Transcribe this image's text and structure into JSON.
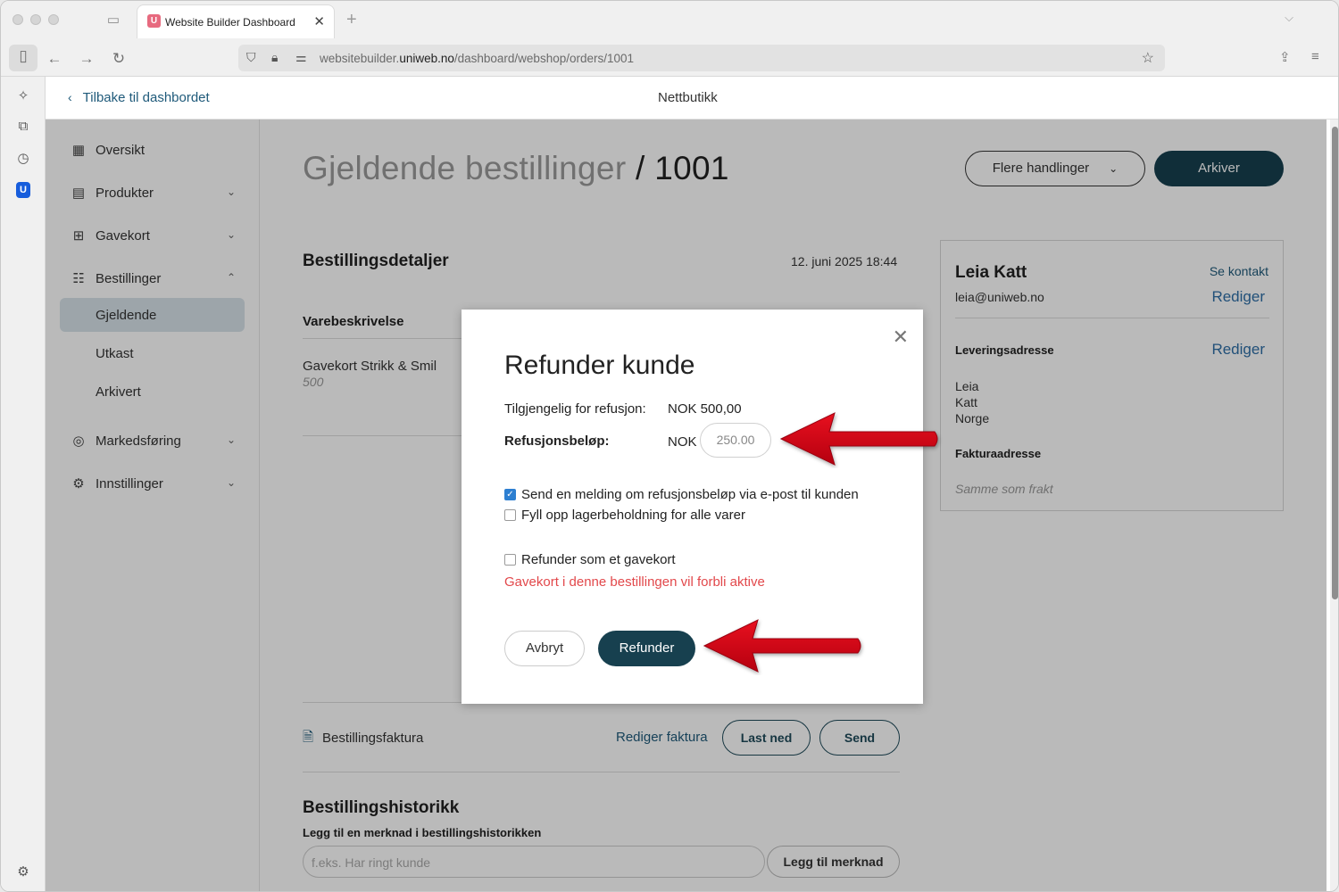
{
  "browser": {
    "tab_title": "Website Builder Dashboard",
    "tab_favicon_letter": "U",
    "url_prefix": "websitebuilder.",
    "url_domain": "uniweb.no",
    "url_path": "/dashboard/webshop/orders/1001"
  },
  "header": {
    "back_label": "Tilbake til dashbordet",
    "center_title": "Nettbutikk"
  },
  "sidebar": {
    "items": [
      {
        "label": "Oversikt",
        "icon": "grid-icon"
      },
      {
        "label": "Produkter",
        "icon": "box-icon"
      },
      {
        "label": "Gavekort",
        "icon": "gift-icon"
      },
      {
        "label": "Bestillinger",
        "icon": "list-icon"
      },
      {
        "label": "Markedsføring",
        "icon": "target-icon"
      },
      {
        "label": "Innstillinger",
        "icon": "gear-icon"
      }
    ],
    "sub_items": [
      "Gjeldende",
      "Utkast",
      "Arkivert"
    ]
  },
  "page": {
    "title_prefix": "Gjeldende bestillinger",
    "title_sep": " / ",
    "order_number": "1001",
    "more_actions_label": "Flere handlinger",
    "archive_label": "Arkiver"
  },
  "order_details": {
    "title": "Bestillingsdetaljer",
    "date": "12. juni 2025 18:44",
    "column_header": "Varebeskrivelse",
    "item_name": "Gavekort Strikk & Smil",
    "item_value": "500"
  },
  "invoice": {
    "label": "Bestillingsfaktura",
    "edit_label": "Rediger faktura",
    "download_label": "Last ned",
    "send_label": "Send"
  },
  "history": {
    "title": "Bestillingshistorikk",
    "note_label": "Legg til en merknad i bestillingshistorikken",
    "note_placeholder": "f.eks. Har ringt kunde",
    "add_note_label": "Legg til merknad"
  },
  "customer": {
    "name": "Leia Katt",
    "see_contact": "Se kontakt",
    "email": "leia@uniweb.no",
    "edit_label": "Rediger",
    "shipping_title": "Leveringsadresse",
    "shipping_lines": [
      "Leia",
      "Katt",
      "Norge"
    ],
    "billing_title": "Fakturaadresse",
    "billing_value": "Samme som frakt"
  },
  "modal": {
    "title": "Refunder kunde",
    "available_label": "Tilgjengelig for refusjon:",
    "available_value": "NOK 500,00",
    "amount_label": "Refusjonsbeløp:",
    "currency": "NOK",
    "amount_value": "250.00",
    "cb_email_label": "Send en melding om refusjonsbeløp via e-post til kunden",
    "cb_email_checked": true,
    "cb_restock_label": "Fyll opp lagerbeholdning for alle varer",
    "cb_restock_checked": false,
    "cb_giftcard_label": "Refunder som et gavekort",
    "cb_giftcard_checked": false,
    "warning": "Gavekort i denne bestillingen vil forbli aktive",
    "cancel_label": "Avbryt",
    "refund_label": "Refunder"
  },
  "colors": {
    "accent_dark": "#17404f",
    "link": "#2e6ea6",
    "warning": "#e2484b",
    "arrow": "#d0021b",
    "active_bg": "#d8e3e9"
  }
}
